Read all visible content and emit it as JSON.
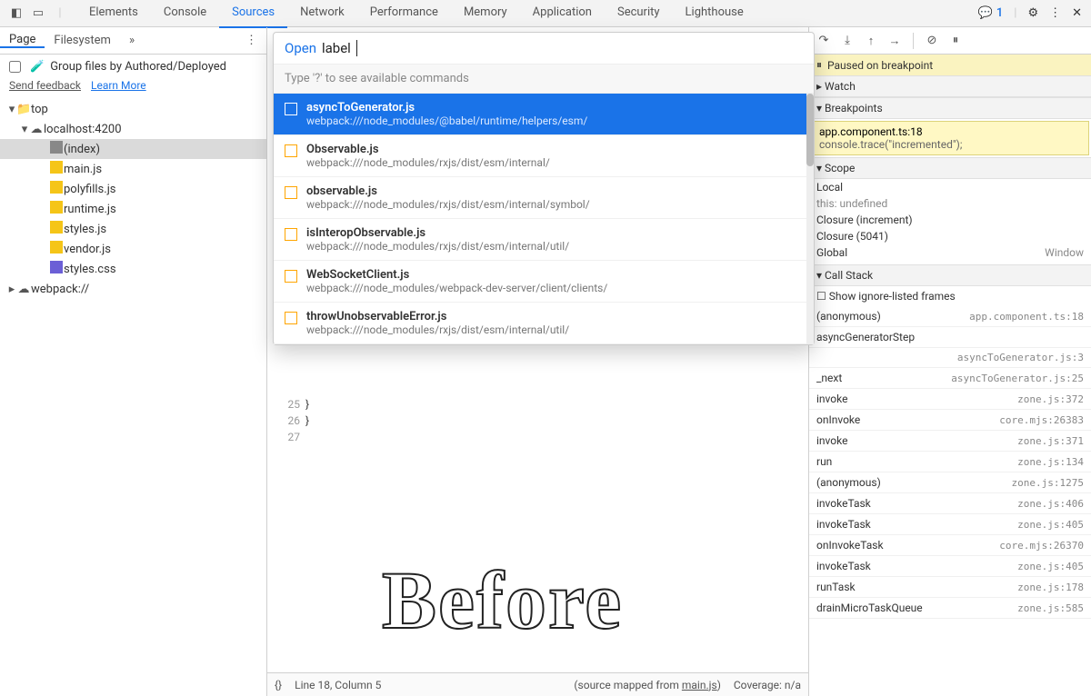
{
  "topbar": {
    "tabs": [
      "Elements",
      "Console",
      "Sources",
      "Network",
      "Performance",
      "Memory",
      "Application",
      "Security",
      "Lighthouse"
    ],
    "activeTab": "Sources",
    "issueCount": "1"
  },
  "sidebar": {
    "tabs": [
      "Page",
      "Filesystem"
    ],
    "activeTab": "Page",
    "groupLabel": "Group files by Authored/Deployed",
    "sendFeedback": "Send feedback",
    "learnMore": "Learn More",
    "tree": [
      {
        "label": "top",
        "depth": 1,
        "type": "folder",
        "expanded": true
      },
      {
        "label": "localhost:4200",
        "depth": 2,
        "type": "cloud",
        "expanded": true
      },
      {
        "label": "(index)",
        "depth": 3,
        "type": "file",
        "selected": true
      },
      {
        "label": "main.js",
        "depth": 3,
        "type": "js"
      },
      {
        "label": "polyfills.js",
        "depth": 3,
        "type": "js"
      },
      {
        "label": "runtime.js",
        "depth": 3,
        "type": "js"
      },
      {
        "label": "styles.js",
        "depth": 3,
        "type": "js"
      },
      {
        "label": "vendor.js",
        "depth": 3,
        "type": "js"
      },
      {
        "label": "styles.css",
        "depth": 3,
        "type": "css"
      },
      {
        "label": "webpack://",
        "depth": 1,
        "type": "cloud",
        "expanded": false
      }
    ]
  },
  "quickopen": {
    "open": "Open",
    "query": "label",
    "hint": "Type '?' to see available commands",
    "items": [
      {
        "title": "asyncToGenerator.js",
        "path": "webpack:///node_modules/@babel/runtime/helpers/esm/",
        "selected": true
      },
      {
        "title": "Observable.js",
        "path": "webpack:///node_modules/rxjs/dist/esm/internal/"
      },
      {
        "title": "observable.js",
        "path": "webpack:///node_modules/rxjs/dist/esm/internal/symbol/"
      },
      {
        "title": "isInteropObservable.js",
        "path": "webpack:///node_modules/rxjs/dist/esm/internal/util/"
      },
      {
        "title": "WebSocketClient.js",
        "path": "webpack:///node_modules/webpack-dev-server/client/clients/"
      },
      {
        "title": "throwUnobservableError.js",
        "path": "webpack:///node_modules/rxjs/dist/esm/internal/util/"
      }
    ]
  },
  "editor": {
    "gutter": [
      "25",
      "26",
      "27"
    ],
    "code": [
      "  }",
      "}",
      ""
    ],
    "status": {
      "braces": "{}",
      "position": "Line 18, Column 5",
      "sourcemap": "(source mapped from ",
      "sourcemapFile": "main.js",
      "sourcemapClose": ")",
      "coverage": "Coverage: n/a"
    }
  },
  "right": {
    "pauseBanner": "Paused on breakpoint",
    "watch": "Watch",
    "breakpoints": "Breakpoints",
    "bpFile": "app.component.ts:18",
    "bpCode": "console.trace(\"incremented\");",
    "scopeHdr": "Scope",
    "scopeLines": [
      {
        "text": "Local"
      },
      {
        "text": "this: undefined",
        "dim": true
      },
      {
        "text": "Closure (increment)"
      },
      {
        "text": "Closure (5041)"
      },
      {
        "text": "Global",
        "rightText": "Window"
      }
    ],
    "callStack": "Call Stack",
    "ignoreListed": "Show ignore-listed frames",
    "frames": [
      {
        "name": "(anonymous)",
        "loc": "app.component.ts:18"
      },
      {
        "name": "asyncGeneratorStep",
        "loc": ""
      },
      {
        "name": "",
        "loc": "asyncToGenerator.js:3"
      },
      {
        "name": "_next",
        "loc": "asyncToGenerator.js:25"
      },
      {
        "name": "invoke",
        "loc": "zone.js:372"
      },
      {
        "name": "onInvoke",
        "loc": "core.mjs:26383"
      },
      {
        "name": "invoke",
        "loc": "zone.js:371"
      },
      {
        "name": "run",
        "loc": "zone.js:134"
      },
      {
        "name": "(anonymous)",
        "loc": "zone.js:1275"
      },
      {
        "name": "invokeTask",
        "loc": "zone.js:406"
      },
      {
        "name": "invokeTask",
        "loc": "zone.js:405"
      },
      {
        "name": "onInvokeTask",
        "loc": "core.mjs:26370"
      },
      {
        "name": "invokeTask",
        "loc": "zone.js:405"
      },
      {
        "name": "runTask",
        "loc": "zone.js:178"
      },
      {
        "name": "drainMicroTaskQueue",
        "loc": "zone.js:585"
      }
    ]
  },
  "overlay": "Before"
}
